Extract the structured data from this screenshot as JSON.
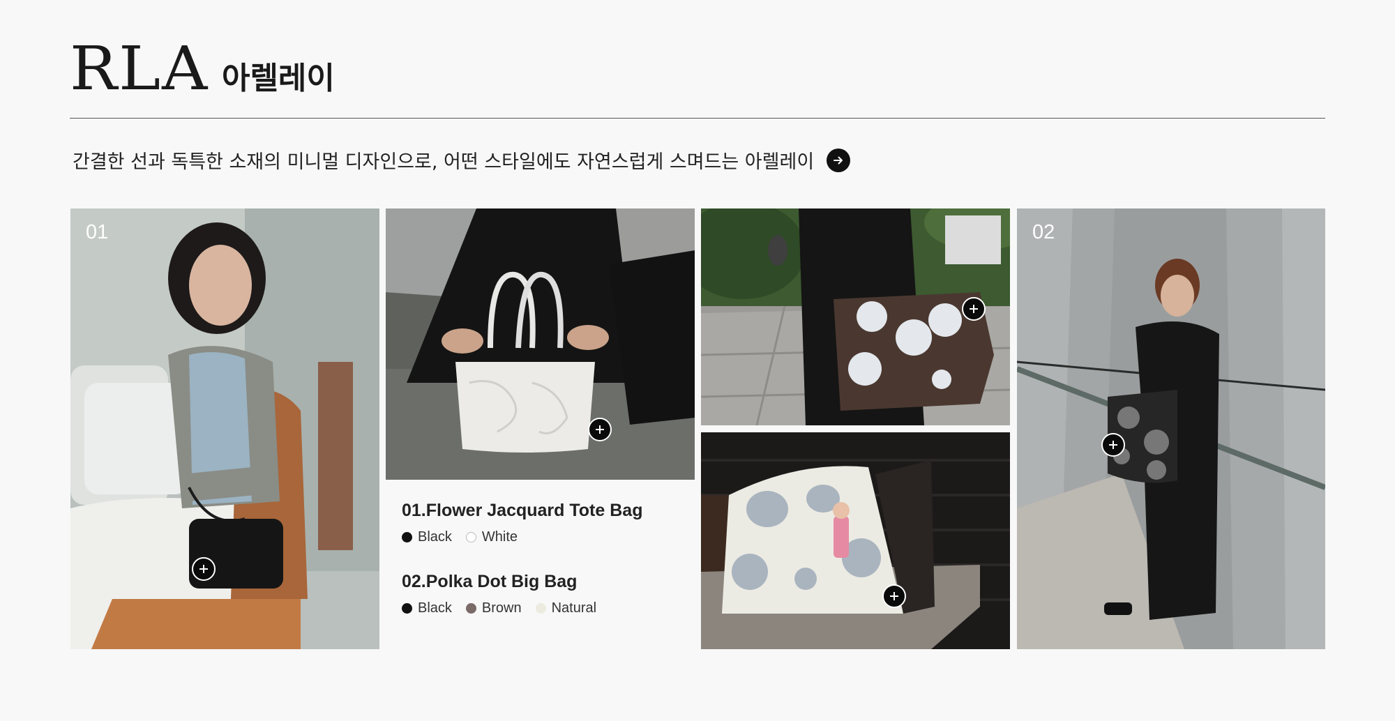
{
  "brand": {
    "logo": "RLA",
    "name": "아렐레이"
  },
  "tagline": "간결한 선과 독특한 소재의 미니멀 디자인으로, 어떤 스타일에도 자연스럽게 스며드는 아렐레이",
  "panels": {
    "first": {
      "number": "01"
    },
    "last": {
      "number": "02"
    }
  },
  "products": [
    {
      "title": "01.Flower Jacquard Tote Bag",
      "colors": [
        {
          "name": "Black",
          "hex": "#111111"
        },
        {
          "name": "White",
          "hex": "#ffffff"
        }
      ]
    },
    {
      "title": "02.Polka Dot Big Bag",
      "colors": [
        {
          "name": "Black",
          "hex": "#111111"
        },
        {
          "name": "Brown",
          "hex": "#7a6a68"
        },
        {
          "name": "Natural",
          "hex": "#ecebdf"
        }
      ]
    }
  ],
  "icons": {
    "arrow": "arrow-right-icon",
    "plus": "plus-icon"
  }
}
